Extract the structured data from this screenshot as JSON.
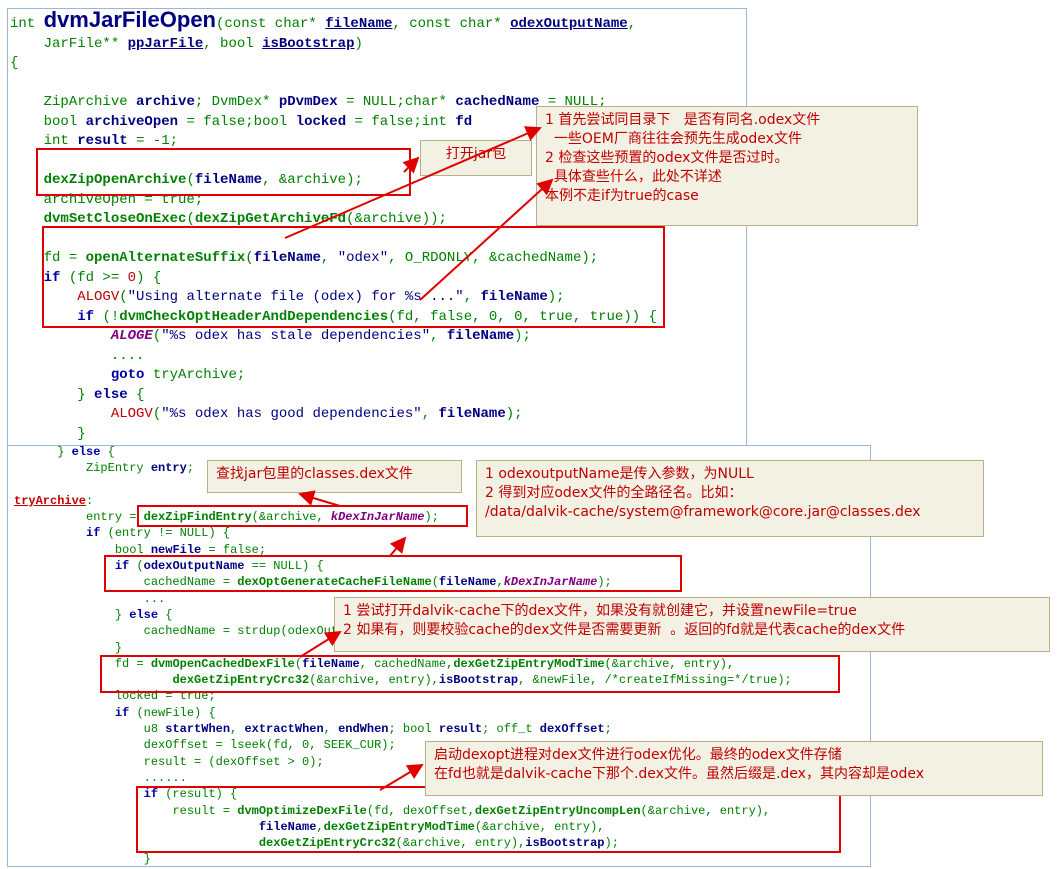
{
  "panel_top": {
    "signature": {
      "ret": "int ",
      "func": "dvmJarFileOpen",
      "open": "(const char* ",
      "p1": "fileName",
      "mid1": ", const char* ",
      "p2": "odexOutputName",
      "mid2": ",",
      "line2a": "    JarFile** ",
      "p3": "ppJarFile",
      "mid3": ", bool ",
      "p4": "isBootstrap",
      "close": ")"
    }
  },
  "notes": {
    "open_jar": "打开jar包",
    "odex_check": [
      "1 首先尝试同目录下   是否有同名.odex文件",
      "  一些OEM厂商往往会预先生成odex文件",
      "2 检查这些预置的odex文件是否过时。",
      "  具体查些什么，此处不详述",
      "本例不走if为true的case"
    ],
    "find_classes": "查找jar包里的classes.dex文件",
    "cache_name": [
      "1 odexoutputName是传入参数，为NULL",
      "2 得到对应odex文件的全路径名。比如：",
      "/data/dalvik-cache/system@framework@core.jar@classes.dex"
    ],
    "open_cache": [
      "1 尝试打开dalvik-cache下的dex文件，如果没有就创建它，并设置newFile=true",
      "2 如果有，则要校验cache的dex文件是否需要更新  。返回的fd就是代表cache的dex文件"
    ],
    "dexopt": [
      "启动dexopt进程对dex文件进行odex优化。最终的odex文件存储",
      "在fd也就是dalvik-cache下那个.dex文件。虽然后缀是.dex，其内容却是odex"
    ]
  }
}
